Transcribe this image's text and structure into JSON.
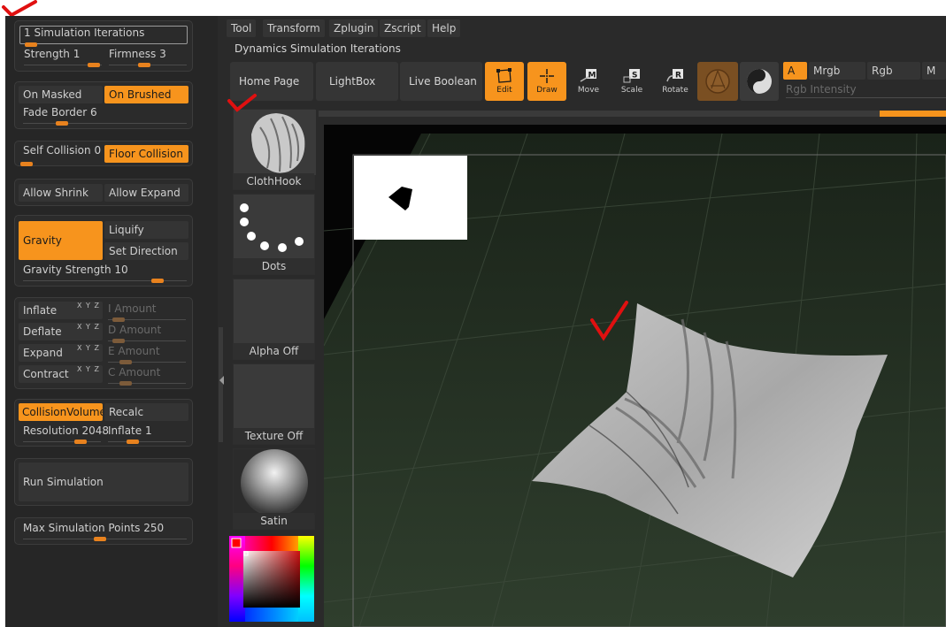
{
  "left_panel": {
    "simulation_iterations": "1 Simulation Iterations",
    "strength_label": "Strength",
    "strength_value": "1",
    "strength_level": 0.9,
    "firmness_label": "Firmness",
    "firmness_value": "3",
    "firmness_level": 0.45,
    "on_masked": "On Masked",
    "on_brushed": "On Brushed",
    "fade_border_label": "Fade Border",
    "fade_border_value": "6",
    "fade_border_level": 0.24,
    "self_collision_label": "Self Collision",
    "self_collision_value": "0",
    "floor_collision": "Floor Collision",
    "allow_shrink": "Allow Shrink",
    "allow_expand": "Allow Expand",
    "gravity": "Gravity",
    "liquify": "Liquify",
    "set_direction": "Set Direction",
    "gravity_strength_label": "Gravity Strength",
    "gravity_strength_value": "10",
    "gravity_strength_level": 0.82,
    "inflate": "Inflate",
    "i_amount": "I Amount",
    "deflate": "Deflate",
    "d_amount": "D Amount",
    "expand": "Expand",
    "e_amount": "E Amount",
    "contract": "Contract",
    "c_amount": "C Amount",
    "xyz": "X Y Z",
    "collision_volume": "CollisionVolume",
    "recalc": "Recalc",
    "resolution_label": "Resolution",
    "resolution_value": "2048",
    "inflate_label": "Inflate",
    "inflate_value": "1",
    "run_simulation": "Run Simulation",
    "max_points_label": "Max Simulation Points",
    "max_points_value": "250",
    "max_points_level": 0.47
  },
  "menu": [
    "Tool",
    "Transform",
    "Zplugin",
    "Zscript",
    "Help"
  ],
  "title_bar": "Dynamics Simulation Iterations",
  "toolbar": {
    "home_page": "Home Page",
    "lightbox": "LightBox",
    "live_boolean": "Live Boolean",
    "edit": "Edit",
    "draw": "Draw",
    "move": "Move",
    "scale": "Scale",
    "rotate": "Rotate",
    "key_m": "M",
    "key_s": "S",
    "key_r": "R",
    "a_label": "A",
    "mrgb": "Mrgb",
    "rgb": "Rgb",
    "m_label": "M",
    "rgb_intensity": "Rgb Intensity"
  },
  "trays": {
    "clothhook": "ClothHook",
    "dots": "Dots",
    "alpha_off": "Alpha Off",
    "texture_off": "Texture Off",
    "satin": "Satin"
  },
  "colors": {
    "accent": "#f7941d",
    "panel": "#262626",
    "check_red": "#e01010"
  }
}
